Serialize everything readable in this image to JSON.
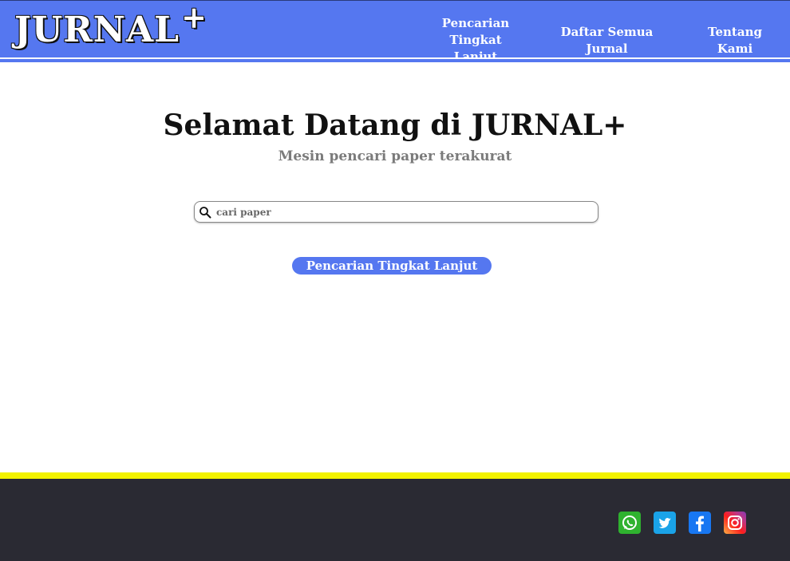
{
  "brand": {
    "name": "JURNAL",
    "plus": "+"
  },
  "nav": {
    "links": [
      {
        "label": "Pencarian\nTingkat Lanjut"
      },
      {
        "label": "Daftar Semua Jurnal"
      },
      {
        "label": "Tentang Kami"
      }
    ]
  },
  "hero": {
    "title": "Selamat Datang di JURNAL+",
    "subtitle": "Mesin pencari paper terakurat"
  },
  "search": {
    "placeholder": "cari paper",
    "value": ""
  },
  "advanced_button": {
    "label": "Pencarian Tingkat Lanjut"
  },
  "footer": {
    "socials": [
      {
        "icon": "whatsapp-icon",
        "color": "#2fb22f"
      },
      {
        "icon": "twitter-icon",
        "color": "#1aa3e8"
      },
      {
        "icon": "facebook-icon",
        "color": "#1877f2"
      },
      {
        "icon": "instagram-icon",
        "color": "#c13584"
      }
    ]
  },
  "colors": {
    "primary": "#5577f0",
    "footer_bg": "#2a2a33",
    "footer_stripe": "#f2f200"
  }
}
